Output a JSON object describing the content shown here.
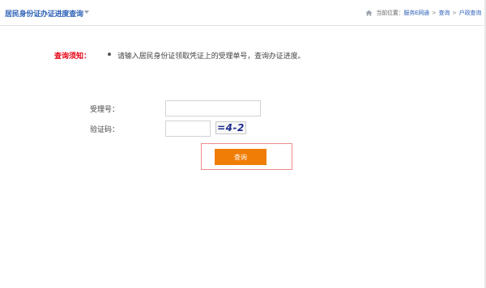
{
  "header": {
    "title": "居民身份证办证进度查询",
    "breadcrumb": {
      "prefix": "当前位置：",
      "items": [
        "服务E网通",
        "查询",
        "户政查询"
      ],
      "separator": ">"
    }
  },
  "notice": {
    "label": "查询须知：",
    "text": "请输入居民身份证领取凭证上的受理单号，查询办证进度。"
  },
  "form": {
    "receipt_label": "受理号：",
    "receipt_value": "",
    "captcha_label": "验证码：",
    "captcha_value": "",
    "captcha_image_text": "=4-2",
    "submit_label": "查询"
  },
  "colors": {
    "title": "#2e62b8",
    "notice_label": "#e60012",
    "button": "#f07d05",
    "button_frame": "#ef8c8c"
  },
  "icons": {
    "home": "home-icon",
    "title_dropdown": "chevron-down-icon"
  }
}
